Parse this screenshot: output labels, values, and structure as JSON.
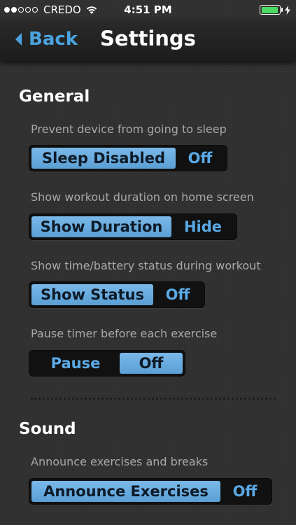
{
  "status_bar": {
    "carrier": "CREDO",
    "time": "4:51 PM",
    "battery_level": 0.95,
    "signal_filled": 2,
    "signal_total": 5
  },
  "nav": {
    "back_label": "Back",
    "title": "Settings"
  },
  "sections": {
    "general": {
      "title": "General",
      "settings": [
        {
          "description": "Prevent device from going to sleep",
          "on_label": "Sleep Disabled",
          "off_label": "Off",
          "selected": "on"
        },
        {
          "description": "Show workout duration on home screen",
          "on_label": "Show Duration",
          "off_label": "Hide",
          "selected": "on"
        },
        {
          "description": "Show time/battery status during workout",
          "on_label": "Show Status",
          "off_label": "Off",
          "selected": "on"
        },
        {
          "description": "Pause timer before each exercise",
          "on_label": "Pause",
          "off_label": "Off",
          "selected": "off"
        }
      ]
    },
    "sound": {
      "title": "Sound",
      "settings": [
        {
          "description": "Announce exercises and breaks",
          "on_label": "Announce Exercises",
          "off_label": "Off",
          "selected": "on"
        }
      ]
    }
  },
  "colors": {
    "accent": "#4ba3e0",
    "segment_active": "#6aaee3",
    "background": "#303030",
    "battery": "#4cd964"
  }
}
